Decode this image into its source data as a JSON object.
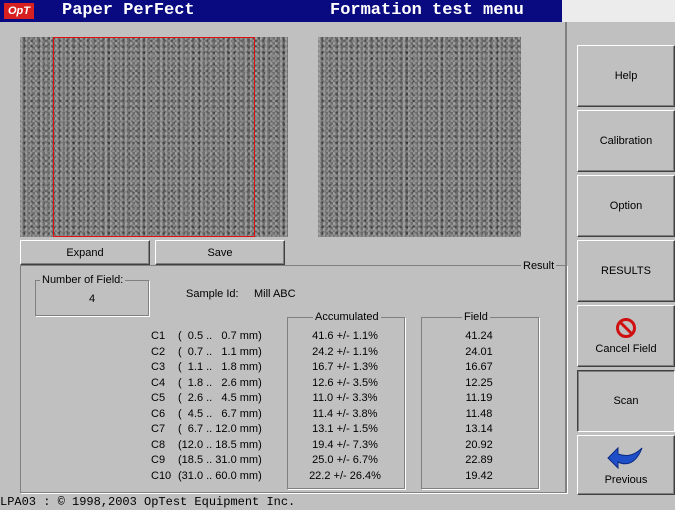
{
  "title_bar": {
    "logo_text": "OpT",
    "app_name": "Paper PerFect",
    "menu_title": "Formation test menu"
  },
  "image_buttons": {
    "expand": "Expand",
    "save": "Save"
  },
  "result": {
    "group_label": "Result",
    "number_of_field_label": "Number of Field:",
    "number_of_field_value": "4",
    "sample_id_label": "Sample Id:",
    "sample_id_value": "Mill ABC",
    "accumulated_header": "Accumulated",
    "field_header": "Field",
    "rows": [
      {
        "cls": "C1",
        "range": "(  0.5 ..   0.7 mm)",
        "acc": "41.6 +/- 1.1%",
        "field": "41.24"
      },
      {
        "cls": "C2",
        "range": "(  0.7 ..   1.1 mm)",
        "acc": "24.2 +/- 1.1%",
        "field": "24.01"
      },
      {
        "cls": "C3",
        "range": "(  1.1 ..   1.8 mm)",
        "acc": "16.7 +/- 1.3%",
        "field": "16.67"
      },
      {
        "cls": "C4",
        "range": "(  1.8 ..   2.6 mm)",
        "acc": "12.6 +/- 3.5%",
        "field": "12.25"
      },
      {
        "cls": "C5",
        "range": "(  2.6 ..   4.5 mm)",
        "acc": "11.0 +/- 3.3%",
        "field": "11.19"
      },
      {
        "cls": "C6",
        "range": "(  4.5 ..   6.7 mm)",
        "acc": "11.4 +/- 3.8%",
        "field": "11.48"
      },
      {
        "cls": "C7",
        "range": "(  6.7 .. 12.0 mm)",
        "acc": "13.1 +/- 1.5%",
        "field": "13.14"
      },
      {
        "cls": "C8",
        "range": "(12.0 .. 18.5 mm)",
        "acc": "19.4 +/- 7.3%",
        "field": "20.92"
      },
      {
        "cls": "C9",
        "range": "(18.5 .. 31.0 mm)",
        "acc": "25.0 +/- 6.7%",
        "field": "22.89"
      },
      {
        "cls": "C10",
        "range": "(31.0 .. 60.0 mm)",
        "acc": "22.2 +/- 26.4%",
        "field": "19.42"
      }
    ]
  },
  "side_buttons": {
    "help": "Help",
    "calibration": "Calibration",
    "option": "Option",
    "results": "RESULTS",
    "cancel_field": "Cancel Field",
    "scan": "Scan",
    "previous": "Previous"
  },
  "icons": {
    "cancel": "no-entry-icon",
    "previous": "back-arrow-icon"
  },
  "colors": {
    "title_bar": "#0a0a80",
    "frame": "#e01010",
    "cancel_icon": "#d01010",
    "arrow_icon": "#1e4fc8"
  },
  "status_bar": {
    "text": "LPA03 :   © 1998,2003 OpTest  Equipment Inc."
  }
}
